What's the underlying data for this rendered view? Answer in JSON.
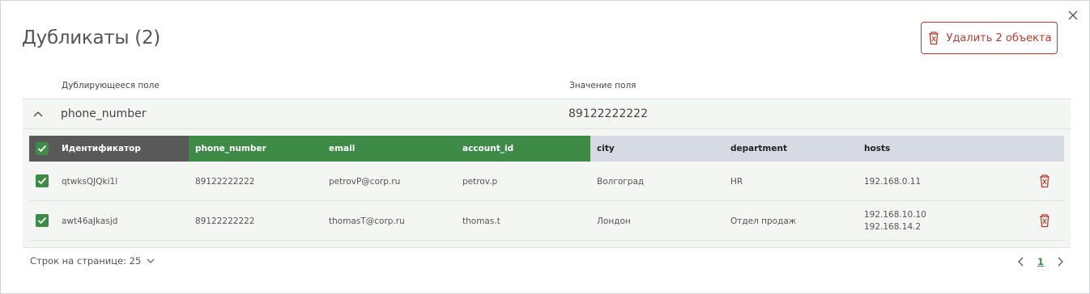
{
  "dialog": {
    "title": "Дубликаты (2)",
    "delete_button_label": "Удалить 2 объекта",
    "close_icon": "close-icon"
  },
  "columns": {
    "duplicate_field": "Дублирующееся поле",
    "field_value": "Значение поля"
  },
  "group": {
    "field": "phone_number",
    "value": "89122222222",
    "expanded": true
  },
  "table": {
    "headers": [
      "Идентификатор",
      "phone_number",
      "email",
      "account_id",
      "city",
      "department",
      "hosts"
    ],
    "rows": [
      {
        "id": "qtwksQJQki1l",
        "phone_number": "89122222222",
        "email": "petrovP@corp.ru",
        "account_id": "petrov.p",
        "city": "Волгоград",
        "department": "HR",
        "hosts": [
          "192.168.0.11"
        ],
        "checked": true
      },
      {
        "id": "awt46aJkasjd",
        "phone_number": "89122222222",
        "email": "thomasT@corp.ru",
        "account_id": "thomas.t",
        "city": "Лондон",
        "department": "Отдел продаж",
        "hosts": [
          "192.168.10.10",
          "192.168.14.2"
        ],
        "checked": true
      }
    ]
  },
  "footer": {
    "rows_per_page_label": "Строк на странице: 25",
    "current_page": "1"
  },
  "colors": {
    "accent_green": "#3d8b47",
    "danger_red": "#c0392b",
    "header_dark": "#595959",
    "header_grey": "#d6dbe3"
  }
}
